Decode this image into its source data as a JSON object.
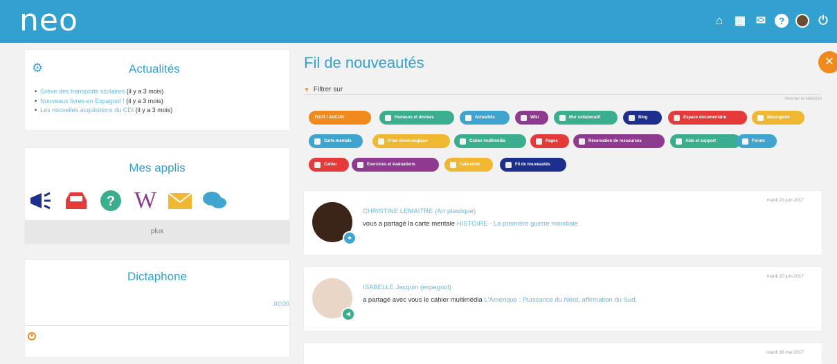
{
  "header": {
    "logo": "neo",
    "icons": [
      "home-icon",
      "apps-grid-icon",
      "mail-icon",
      "help-icon",
      "user-avatar-icon",
      "power-icon"
    ],
    "color": "#33a1cf"
  },
  "news_widget": {
    "title": "Actualités",
    "items": [
      {
        "label": "Grève des transports scolaires",
        "age": "(il y a 3 mois)"
      },
      {
        "label": "Nouveaux livres en Espagnol !",
        "age": "(il y a 3 mois)"
      },
      {
        "label": "Les nouvelles acquisitions du CDI",
        "age": "(il y a 3 mois)"
      }
    ]
  },
  "apps_widget": {
    "title": "Mes applis",
    "icons": [
      "megaphone-icon",
      "inbox-tray-icon",
      "help-circle-icon",
      "wiki-icon",
      "envelope-icon",
      "chat-bubbles-icon"
    ],
    "more_label": "plus"
  },
  "dictaphone": {
    "title": "Dictaphone",
    "time": "00:00"
  },
  "feed": {
    "title": "Fil de nouveautés",
    "filter_label": "Filtrer sur",
    "invert_label": "Inverser la sélection",
    "chips": [
      {
        "label": "TOUT / AUCUN",
        "color": "#f08a1c"
      },
      {
        "label": "Humeurs et devises",
        "color": "#3aae8e"
      },
      {
        "label": "Actualités",
        "color": "#3fa5cf"
      },
      {
        "label": "Wiki",
        "color": "#8e3a8e"
      },
      {
        "label": "Mur collaboratif",
        "color": "#3aae8e"
      },
      {
        "label": "Blog",
        "color": "#1c2f8c"
      },
      {
        "label": "Espace documentaire",
        "color": "#e43a3a"
      },
      {
        "label": "Messagerie",
        "color": "#f0b830"
      },
      {
        "label": "Carte mentale",
        "color": "#3fa5cf"
      },
      {
        "label": "Frise chronologique",
        "color": "#f0b830"
      },
      {
        "label": "Cahier multimédia",
        "color": "#3aae8e"
      },
      {
        "label": "Pages",
        "color": "#e43a3a"
      },
      {
        "label": "Réservation de ressources",
        "color": "#8e3a8e"
      },
      {
        "label": "Aide et support",
        "color": "#3aae8e"
      },
      {
        "label": "Forum",
        "color": "#3fa5cf"
      },
      {
        "label": "Cahier",
        "color": "#e43a3a"
      },
      {
        "label": "Exercices et évaluations",
        "color": "#8e3a8e"
      },
      {
        "label": "Calendrier",
        "color": "#f0b830"
      },
      {
        "label": "Fil de nouveautés",
        "color": "#1c2f8c"
      }
    ],
    "posts": [
      {
        "date": "mardi 20 juin 2017",
        "author": "CHRISTINE LEMAITRE (Art plastique)",
        "action": "vous a partagé la carte mentale ",
        "object": "HISTOIRE - La première guerre mondiale",
        "badge_color": "#3fa5cf",
        "avatar_color": "#3b2418"
      },
      {
        "date": "mardi 20 juin 2017",
        "author": "ISABELLE Jacquin (espagnol)",
        "action": "a partagé avec vous le cahier multimédia ",
        "object": "L'Amérique : Puissance du Nord, affirmation du Sud.",
        "badge_color": "#3aae8e",
        "avatar_color": "#d8b59a"
      },
      {
        "date": "mardi 30 mai 2017"
      }
    ]
  }
}
